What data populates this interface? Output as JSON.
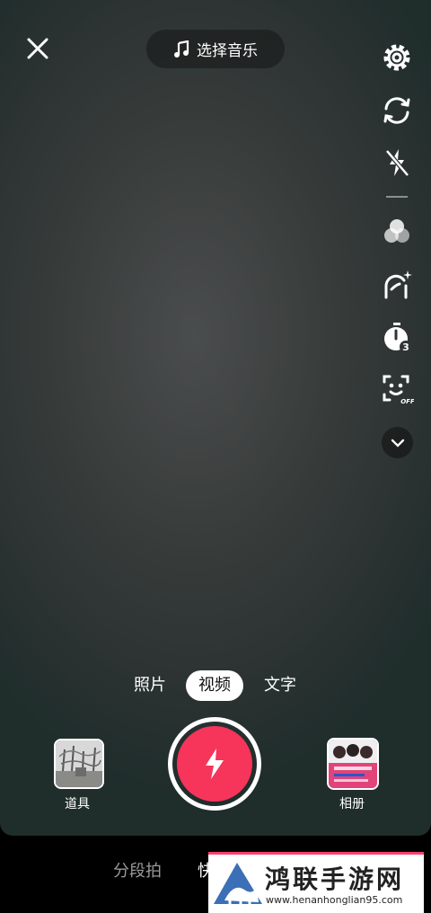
{
  "header": {
    "music_label": "选择音乐"
  },
  "rail": {
    "icons": [
      "settings-icon",
      "flip-camera-icon",
      "flash-off-icon",
      "filter-icon",
      "beauty-icon",
      "timer-icon",
      "face-detect-icon"
    ],
    "timer_badge": "3",
    "face_badge": "OFF"
  },
  "modes": {
    "photo": "照片",
    "video": "视频",
    "text": "文字",
    "active": "video"
  },
  "controls": {
    "props_label": "道具",
    "album_label": "相册"
  },
  "bottom_tabs": {
    "segmented": "分段拍",
    "partial": "快"
  },
  "watermark": {
    "title": "鸿联手游网",
    "url": "www.henanhonglian95.com"
  },
  "colors": {
    "record": "#f7345a",
    "accent": "#ff3f6c"
  }
}
